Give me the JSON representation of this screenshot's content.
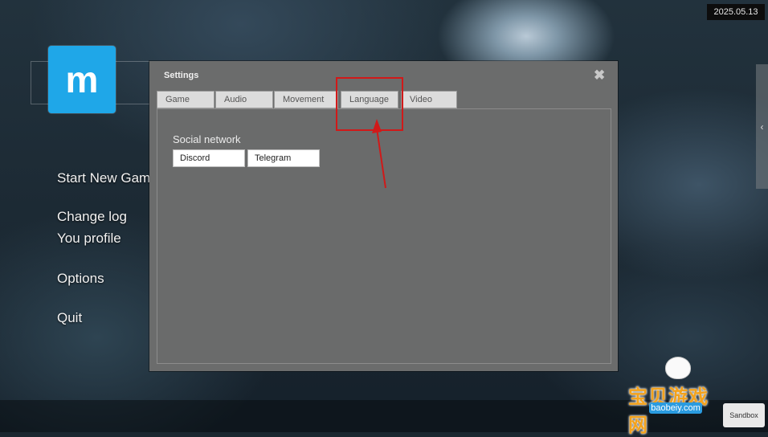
{
  "header": {
    "date": "2025.05.13"
  },
  "logo": {
    "letter": "m"
  },
  "main_menu": {
    "start_new_game": "Start New Gam",
    "change_log": "Change log",
    "your_profile": "You profile",
    "options": "Options",
    "quit": "Quit"
  },
  "settings": {
    "title": "Settings",
    "close_glyph": "✖",
    "tabs": [
      {
        "label": "Game"
      },
      {
        "label": "Audio"
      },
      {
        "label": "Movement"
      },
      {
        "label": "Language"
      },
      {
        "label": "Video"
      }
    ],
    "active_tab": "Language",
    "section_label": "Social network",
    "buttons": {
      "discord": "Discord",
      "telegram": "Telegram"
    }
  },
  "side_panel": {
    "toggle_glyph": "‹"
  },
  "footer": {
    "sandbox": "Sandbox"
  },
  "watermark": {
    "text": "宝贝游戏网",
    "url": "baobeiy.com"
  },
  "annotation": {
    "color": "#d11919"
  },
  "colors": {
    "logo_blue": "#1fa7e8",
    "dialog_bg": "#6b6c6c",
    "tab_bg": "#dcdcdc"
  }
}
